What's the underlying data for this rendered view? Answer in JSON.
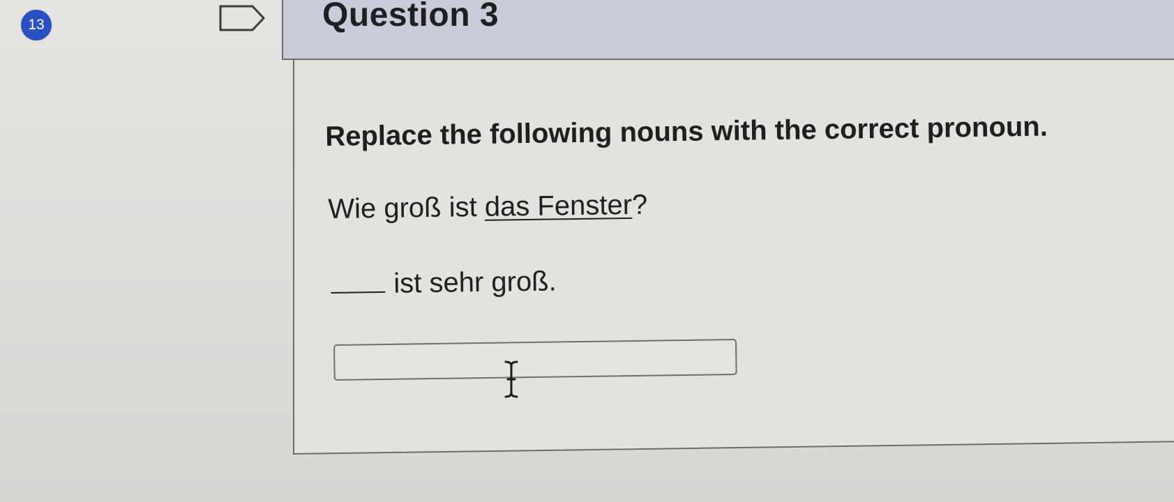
{
  "question": {
    "number": "13",
    "title": "Question 3",
    "instructions": "Replace the following nouns with the correct pronoun.",
    "prompt_before": "Wie groß ist ",
    "prompt_underlined": "das Fenster",
    "prompt_after": "?",
    "sentence_rest": "ist sehr groß.",
    "answer": {
      "value": "",
      "placeholder": ""
    }
  },
  "colors": {
    "number_badge": "#2b50c2",
    "header_background": "#c8ccd8",
    "page_background": "#dededb"
  },
  "icons": {
    "flag": "flag-outline-icon",
    "cursor": "text-cursor-icon"
  }
}
